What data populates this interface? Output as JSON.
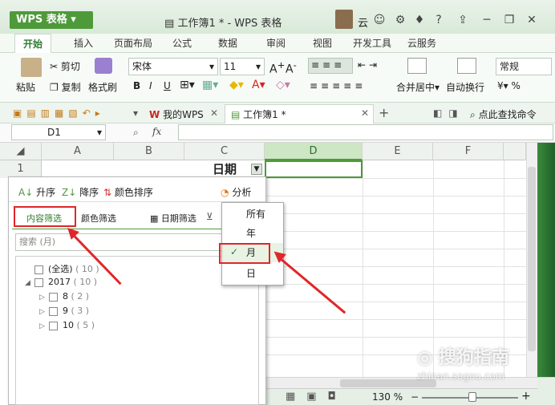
{
  "app": {
    "name": "WPS 表格",
    "title": "工作簿1 * - WPS 表格",
    "user": "云"
  },
  "ribbon_tabs": [
    "开始",
    "插入",
    "页面布局",
    "公式",
    "数据",
    "审阅",
    "视图",
    "开发工具",
    "云服务"
  ],
  "ribbon": {
    "paste": "粘贴",
    "cut": "剪切",
    "copy": "复制",
    "format_painter": "格式刷",
    "font_name": "宋体",
    "font_size": "11",
    "merge_center": "合并居中",
    "wrap_text": "自动换行",
    "number_format": "常规"
  },
  "doc_tabs": {
    "mywps": "我的WPS",
    "workbook": "工作簿1 *",
    "search": "点此查找命令"
  },
  "formula": {
    "cell_ref": "D1",
    "fx": "fx"
  },
  "sheet": {
    "columns": [
      "A",
      "B",
      "C",
      "D",
      "E",
      "F"
    ],
    "row1": "1",
    "c1_value": "日期"
  },
  "filter_popup": {
    "sort_asc": "升序",
    "sort_desc": "降序",
    "sort_color": "颜色排序",
    "analysis": "分析",
    "tab_content": "内容筛选",
    "tab_color": "颜色筛选",
    "tab_date": "日期筛选",
    "search_placeholder": "搜索 (月)",
    "tree": [
      {
        "label": "(全选)",
        "count": "( 10 )"
      },
      {
        "label": "2017",
        "count": "( 10 )"
      },
      {
        "label": "8",
        "count": "( 2 )"
      },
      {
        "label": "9",
        "count": "( 3 )"
      },
      {
        "label": "10",
        "count": "( 5 )"
      }
    ]
  },
  "date_group_menu": {
    "items": [
      "所有",
      "年",
      "月",
      "日"
    ],
    "selected": "月"
  },
  "status": {
    "zoom": "130 %"
  },
  "watermark": {
    "text": "搜狗指南",
    "url": "zhinan.sogou.com"
  },
  "colors": {
    "accent": "#4e9a3a",
    "highlight_red": "#e0262a"
  }
}
